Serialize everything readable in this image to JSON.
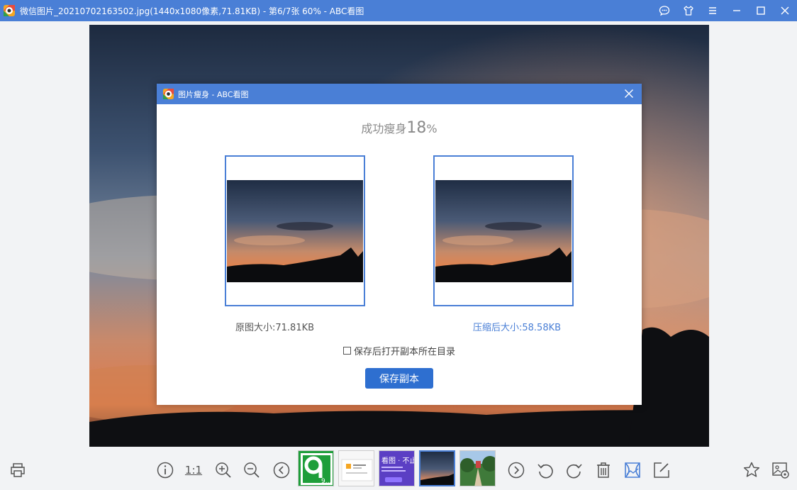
{
  "window": {
    "title": "微信图片_20210702163502.jpg(1440x1080像素,71.81KB) - 第6/7张 60% - ABC看图",
    "icons": [
      "chat-icon",
      "skin-icon",
      "menu-icon",
      "minimize-icon",
      "maximize-icon",
      "close-icon"
    ]
  },
  "dialog": {
    "title": "图片瘦身 - ABC看图",
    "success_prefix": "成功瘦身",
    "success_value": "18",
    "success_suffix": "%",
    "original_size": "原图大小:71.81KB",
    "compressed_size": "压缩后大小:58.58KB",
    "open_dir_label": "保存后打开副本所在目录",
    "save_label": "保存副本"
  },
  "toolbar": {
    "one_to_one": "1:1",
    "thumb_labels": {
      "green": "9...",
      "purple": "看图 · 不止"
    },
    "icons": [
      "print-icon",
      "info-icon",
      "zoom-in-icon",
      "zoom-out-icon",
      "prev-icon",
      "next-icon",
      "rotate-left-icon",
      "rotate-right-icon",
      "delete-icon",
      "slim-icon",
      "edit-icon",
      "favorite-icon",
      "image-settings-icon"
    ]
  },
  "colors": {
    "accent": "#4a7fd6",
    "button": "#2e6fd0"
  }
}
